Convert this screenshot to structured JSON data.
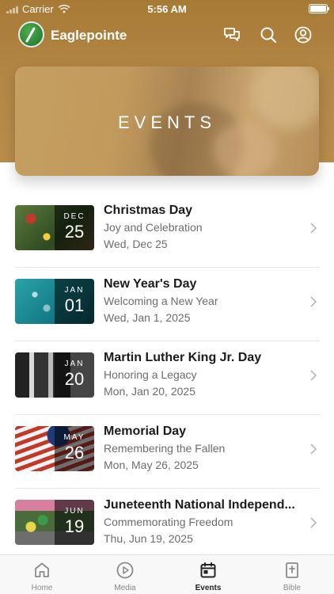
{
  "status_bar": {
    "carrier": "Carrier",
    "time": "5:56 AM"
  },
  "app": {
    "name": "Eaglepointe"
  },
  "banner": {
    "title": "EVENTS"
  },
  "events": [
    {
      "title": "Christmas Day",
      "subtitle": "Joy and Celebration",
      "date": "Wed, Dec 25",
      "month": "DEC",
      "day": "25"
    },
    {
      "title": "New Year's Day",
      "subtitle": "Welcoming a New Year",
      "date": "Wed, Jan 1, 2025",
      "month": "JAN",
      "day": "01"
    },
    {
      "title": "Martin Luther King Jr. Day",
      "subtitle": "Honoring a Legacy",
      "date": "Mon, Jan 20, 2025",
      "month": "JAN",
      "day": "20"
    },
    {
      "title": "Memorial Day",
      "subtitle": "Remembering the Fallen",
      "date": "Mon, May 26, 2025",
      "month": "MAY",
      "day": "26"
    },
    {
      "title": "Juneteenth National Independ...",
      "subtitle": "Commemorating Freedom",
      "date": "Thu, Jun 19, 2025",
      "month": "JUN",
      "day": "19"
    }
  ],
  "tabs": [
    {
      "label": "Home",
      "icon": "home-icon"
    },
    {
      "label": "Media",
      "icon": "play-icon"
    },
    {
      "label": "Events",
      "icon": "calendar-icon",
      "active": true
    },
    {
      "label": "Bible",
      "icon": "bible-icon"
    }
  ],
  "colors": {
    "header": "#b48847",
    "active_tab": "#222222",
    "inactive_tab": "#888888"
  }
}
